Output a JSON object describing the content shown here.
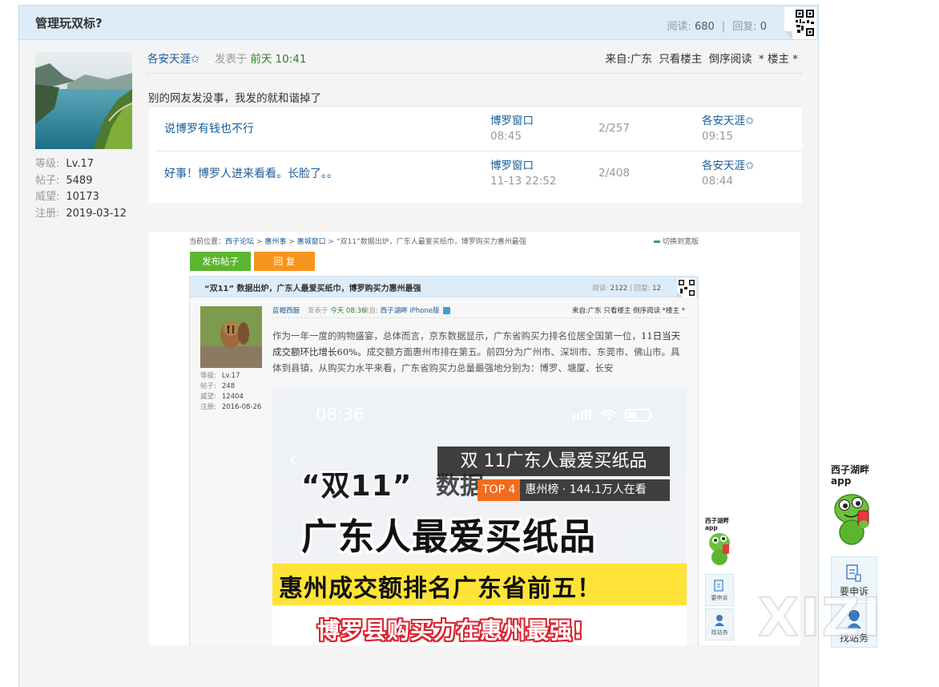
{
  "thread": {
    "title": "管理玩双标?",
    "stats": {
      "read_label": "阅读:",
      "read_value": "680",
      "separator": "|",
      "reply_label": "回复:",
      "reply_value": "0"
    }
  },
  "author": {
    "level_label": "等级:",
    "level_value": "Lv.17",
    "posts_label": "帖子:",
    "posts_value": "5489",
    "prestige_label": "威望:",
    "prestige_value": "10173",
    "reg_label": "注册:",
    "reg_value": "2019-03-12"
  },
  "post": {
    "author_name": "各安天涯✩",
    "posted_label": "发表于",
    "posted_day": "前天",
    "posted_time": "10:41",
    "from": "来自:广东",
    "only_author": "只看楼主",
    "reverse_read": "倒序阅读",
    "floor": "* 楼主 *",
    "body": "别的网友发没事，我发的就和谐掉了"
  },
  "related": [
    {
      "title": "说博罗有钱也不行",
      "forum": "博罗窗口",
      "forum_time": "08:45",
      "count": "2/257",
      "last_user": "各安天涯✩",
      "last_time": "09:15"
    },
    {
      "title": "好事！博罗人进来看看。长脸了。。",
      "forum": "博罗窗口",
      "forum_time": "11-13 22:52",
      "count": "2/408",
      "last_user": "各安天涯✩",
      "last_time": "08:44"
    }
  ],
  "screenshot": {
    "crumb_prefix": "当前位置：",
    "crumb_site": "西子论坛",
    "crumb_sep": ">",
    "crumb_board1": "惠州事",
    "crumb_board2": "惠城窗口",
    "crumb_topic": "“双11”数据出炉，广东人最爱买纸巾，博罗购买力惠州最强",
    "wide_toggle": "切换到宽版",
    "btn_post": "发布帖子",
    "btn_reply": "回 复",
    "inner_title": "“双11” 数据出炉，广东人最爱买纸巾，博罗购买力惠州最强",
    "inner_read_label": "阅读:",
    "inner_read_value": "2122",
    "inner_sep": "|",
    "inner_reply_label": "回复:",
    "inner_reply_value": "12",
    "inner_author": "蓝帽西服",
    "inner_posted_label": "发表于",
    "inner_posted": "今天 08:36",
    "inner_source_label": "来自:",
    "inner_source_app": "西子湖畔",
    "inner_source_device": "iPhone版",
    "inner_actions": "来自:广东 只看楼主 倒序阅读 *楼主 *",
    "inner_meta": {
      "level_label": "等级:",
      "level_value": "Lv.17",
      "posts_label": "帖子:",
      "posts_value": "248",
      "prestige_label": "威望:",
      "prestige_value": "12404",
      "reg_label": "注册:",
      "reg_value": "2016-08-26"
    },
    "inner_body_1": "作为一年一度的购物盛宴，总体而言，京东数据显示，广东省购买力排名位居全国第一位，",
    "inner_body_2": "11日当天成交额环比增长60%。",
    "inner_body_3": "成交额方面惠州市排在第五。前四分为广州市、深圳市、东莞市、佛山市。具体到县镇，从购买力水平来看，广东省购买力总量最强地分别为：博罗、塘厦、长安",
    "phone_time": "08:36",
    "badge_main": "双 11广东人最爱买纸品",
    "badge_top": "TOP 4",
    "badge_sub": "惠州榜 · 144.1万人在看",
    "art_quote": "“双11”",
    "art_quote_faint": "数据",
    "art_line1": "广东人最爱买纸品",
    "art_line2": "惠州成交额排名广东省前五！",
    "art_line3": "博罗县购买力在惠州最强!",
    "mini_app_label": "西子湖畔app",
    "mini_complain": "要申诉",
    "mini_station": "找站务"
  },
  "side": {
    "app_label": "西子湖畔app",
    "complain": "要申诉",
    "station": "找站务"
  },
  "watermark": "XIZI",
  "colors": {
    "header_bg": "#dcecf8",
    "link": "#1a5c99",
    "green_time": "#2e7d32",
    "post_btn": "#5cb531",
    "reply_btn": "#f7941d"
  }
}
